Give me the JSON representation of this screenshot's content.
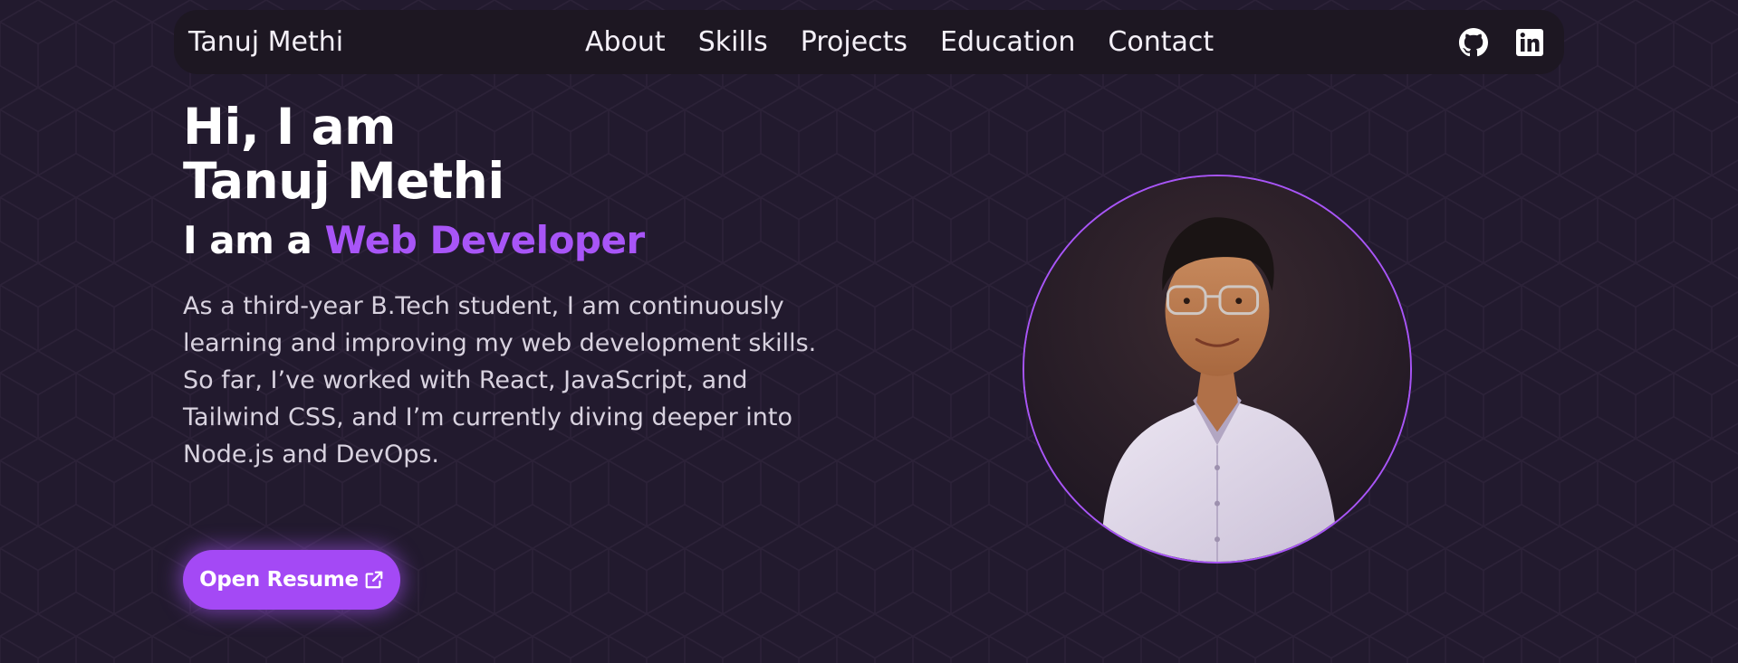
{
  "nav": {
    "brand": "Tanuj Methi",
    "links": [
      "About",
      "Skills",
      "Projects",
      "Education",
      "Contact"
    ],
    "icons": [
      "github-icon",
      "linkedin-icon"
    ]
  },
  "hero": {
    "greeting": "Hi, I am",
    "name": "Tanuj Methi",
    "role_prefix": "I am a",
    "role": "Web Developer",
    "description": "As a third-year B.Tech student, I am continuously learning and improving my web development skills. So far, I’ve worked with React, JavaScript, and Tailwind CSS, and I’m currently diving deeper into Node.js and DevOps.",
    "resume_button": "Open Resume",
    "resume_icon": "external-link-icon"
  },
  "colors": {
    "background": "#221a2e",
    "navbar": "#1d1722",
    "accent": "#a855f7",
    "text": "#ffffff"
  }
}
